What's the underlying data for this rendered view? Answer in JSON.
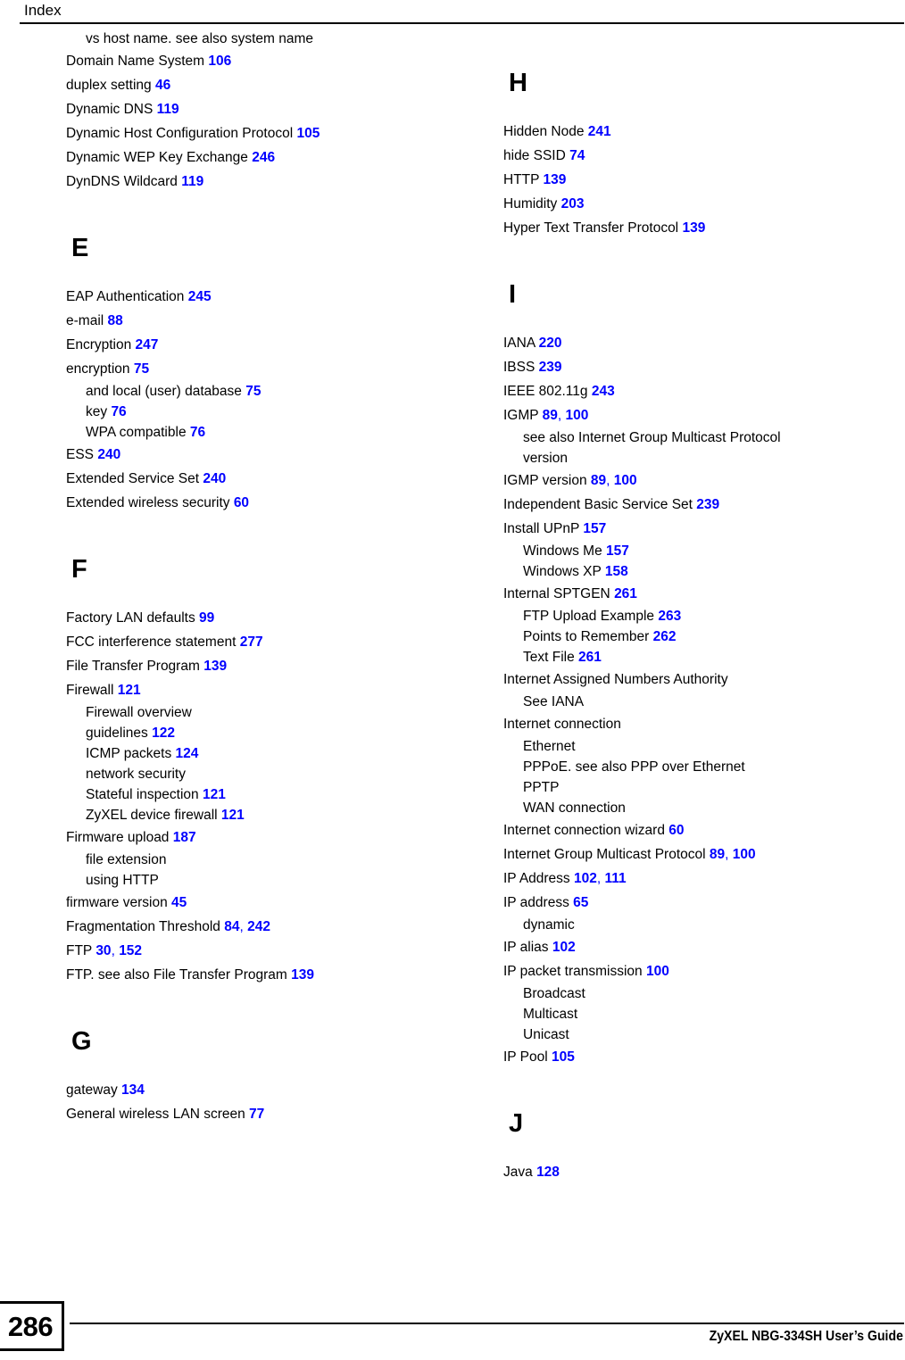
{
  "header": {
    "title": "Index"
  },
  "footer": {
    "page_number": "286",
    "guide_title": "ZyXEL NBG-334SH User’s Guide"
  },
  "colors": {
    "page_reference": "#0000FF",
    "text": "#000000",
    "background": "#FFFFFF"
  },
  "columns": [
    {
      "name": "left-column",
      "sections": [
        {
          "letter": null,
          "continued": true,
          "entries": [
            {
              "level": "sub",
              "text": "vs host name. see also system name",
              "pages": []
            },
            {
              "level": "main",
              "text": "Domain Name System",
              "pages": [
                "106"
              ]
            },
            {
              "level": "main",
              "text": "duplex setting",
              "pages": [
                "46"
              ]
            },
            {
              "level": "main",
              "text": "Dynamic DNS",
              "pages": [
                "119"
              ]
            },
            {
              "level": "main",
              "text": "Dynamic Host Configuration Protocol",
              "pages": [
                "105"
              ]
            },
            {
              "level": "main",
              "text": "Dynamic WEP Key Exchange",
              "pages": [
                "246"
              ]
            },
            {
              "level": "main",
              "text": "DynDNS Wildcard",
              "pages": [
                "119"
              ]
            }
          ]
        },
        {
          "letter": "E",
          "continued": false,
          "entries": [
            {
              "level": "main",
              "text": "EAP Authentication",
              "pages": [
                "245"
              ]
            },
            {
              "level": "main",
              "text": "e-mail",
              "pages": [
                "88"
              ]
            },
            {
              "level": "main",
              "text": "Encryption",
              "pages": [
                "247"
              ]
            },
            {
              "level": "main",
              "text": "encryption",
              "pages": [
                "75"
              ]
            },
            {
              "level": "sub",
              "text": "and local (user) database",
              "pages": [
                "75"
              ]
            },
            {
              "level": "sub",
              "text": "key",
              "pages": [
                "76"
              ]
            },
            {
              "level": "sub",
              "text": "WPA compatible",
              "pages": [
                "76"
              ]
            },
            {
              "level": "main",
              "text": "ESS",
              "pages": [
                "240"
              ]
            },
            {
              "level": "main",
              "text": "Extended Service Set",
              "pages": [
                "240"
              ]
            },
            {
              "level": "main",
              "text": "Extended wireless security",
              "pages": [
                "60"
              ]
            }
          ]
        },
        {
          "letter": "F",
          "continued": false,
          "entries": [
            {
              "level": "main",
              "text": "Factory LAN defaults",
              "pages": [
                "99"
              ]
            },
            {
              "level": "main",
              "text": "FCC interference statement",
              "pages": [
                "277"
              ]
            },
            {
              "level": "main",
              "text": "File Transfer Program",
              "pages": [
                "139"
              ]
            },
            {
              "level": "main",
              "text": "Firewall",
              "pages": [
                "121"
              ]
            },
            {
              "level": "sub",
              "text": "Firewall overview",
              "pages": []
            },
            {
              "level": "sub",
              "text": "guidelines",
              "pages": [
                "122"
              ]
            },
            {
              "level": "sub",
              "text": "ICMP packets",
              "pages": [
                "124"
              ]
            },
            {
              "level": "sub",
              "text": "network security",
              "pages": []
            },
            {
              "level": "sub",
              "text": "Stateful inspection",
              "pages": [
                "121"
              ]
            },
            {
              "level": "sub",
              "text": "ZyXEL device firewall",
              "pages": [
                "121"
              ]
            },
            {
              "level": "main",
              "text": "Firmware upload",
              "pages": [
                "187"
              ]
            },
            {
              "level": "sub",
              "text": "file extension",
              "pages": []
            },
            {
              "level": "sub",
              "text": "using HTTP",
              "pages": []
            },
            {
              "level": "main",
              "text": "firmware version",
              "pages": [
                "45"
              ]
            },
            {
              "level": "main",
              "text": "Fragmentation Threshold",
              "pages": [
                "84",
                "242"
              ]
            },
            {
              "level": "main",
              "text": "FTP",
              "pages": [
                "30",
                "152"
              ]
            },
            {
              "level": "main",
              "text": "FTP. see also File Transfer Program",
              "pages": [
                "139"
              ]
            }
          ]
        },
        {
          "letter": "G",
          "continued": false,
          "entries": [
            {
              "level": "main",
              "text": "gateway",
              "pages": [
                "134"
              ]
            },
            {
              "level": "main",
              "text": "General wireless LAN screen",
              "pages": [
                "77"
              ]
            }
          ]
        }
      ]
    },
    {
      "name": "right-column",
      "sections": [
        {
          "letter": "H",
          "continued": false,
          "entries": [
            {
              "level": "main",
              "text": "Hidden Node",
              "pages": [
                "241"
              ]
            },
            {
              "level": "main",
              "text": "hide SSID",
              "pages": [
                "74"
              ]
            },
            {
              "level": "main",
              "text": "HTTP",
              "pages": [
                "139"
              ]
            },
            {
              "level": "main",
              "text": "Humidity",
              "pages": [
                "203"
              ]
            },
            {
              "level": "main",
              "text": "Hyper Text Transfer Protocol",
              "pages": [
                "139"
              ]
            }
          ]
        },
        {
          "letter": "I",
          "continued": false,
          "entries": [
            {
              "level": "main",
              "text": "IANA",
              "pages": [
                "220"
              ]
            },
            {
              "level": "main",
              "text": "IBSS",
              "pages": [
                "239"
              ]
            },
            {
              "level": "main",
              "text": "IEEE 802.11g",
              "pages": [
                "243"
              ]
            },
            {
              "level": "main",
              "text": "IGMP",
              "pages": [
                "89",
                "100"
              ]
            },
            {
              "level": "sub",
              "text": "see also Internet Group Multicast Protocol",
              "pages": []
            },
            {
              "level": "sub",
              "text": "version",
              "pages": []
            },
            {
              "level": "main",
              "text": "IGMP version",
              "pages": [
                "89",
                "100"
              ]
            },
            {
              "level": "main",
              "text": "Independent Basic Service Set",
              "pages": [
                "239"
              ]
            },
            {
              "level": "main",
              "text": "Install UPnP",
              "pages": [
                "157"
              ]
            },
            {
              "level": "sub",
              "text": "Windows Me",
              "pages": [
                "157"
              ]
            },
            {
              "level": "sub",
              "text": "Windows XP",
              "pages": [
                "158"
              ]
            },
            {
              "level": "main",
              "text": "Internal SPTGEN",
              "pages": [
                "261"
              ]
            },
            {
              "level": "sub",
              "text": "FTP Upload Example",
              "pages": [
                "263"
              ]
            },
            {
              "level": "sub",
              "text": "Points to Remember",
              "pages": [
                "262"
              ]
            },
            {
              "level": "sub",
              "text": "Text File",
              "pages": [
                "261"
              ]
            },
            {
              "level": "main",
              "text": "Internet Assigned Numbers Authority",
              "pages": []
            },
            {
              "level": "sub",
              "text": "See IANA",
              "pages": []
            },
            {
              "level": "main",
              "text": "Internet connection",
              "pages": []
            },
            {
              "level": "sub",
              "text": "Ethernet",
              "pages": []
            },
            {
              "level": "sub",
              "text": "PPPoE. see also PPP over Ethernet",
              "pages": []
            },
            {
              "level": "sub",
              "text": "PPTP",
              "pages": []
            },
            {
              "level": "sub",
              "text": "WAN connection",
              "pages": []
            },
            {
              "level": "main",
              "text": "Internet connection wizard",
              "pages": [
                "60"
              ]
            },
            {
              "level": "main",
              "text": "Internet Group Multicast Protocol",
              "pages": [
                "89",
                "100"
              ]
            },
            {
              "level": "main",
              "text": "IP Address",
              "pages": [
                "102",
                "111"
              ]
            },
            {
              "level": "main",
              "text": "IP address",
              "pages": [
                "65"
              ]
            },
            {
              "level": "sub",
              "text": "dynamic",
              "pages": []
            },
            {
              "level": "main",
              "text": "IP alias",
              "pages": [
                "102"
              ]
            },
            {
              "level": "main",
              "text": "IP packet transmission",
              "pages": [
                "100"
              ]
            },
            {
              "level": "sub",
              "text": "Broadcast",
              "pages": []
            },
            {
              "level": "sub",
              "text": "Multicast",
              "pages": []
            },
            {
              "level": "sub",
              "text": "Unicast",
              "pages": []
            },
            {
              "level": "main",
              "text": "IP Pool",
              "pages": [
                "105"
              ]
            }
          ]
        },
        {
          "letter": "J",
          "continued": false,
          "entries": [
            {
              "level": "main",
              "text": "Java",
              "pages": [
                "128"
              ]
            }
          ]
        }
      ]
    }
  ]
}
